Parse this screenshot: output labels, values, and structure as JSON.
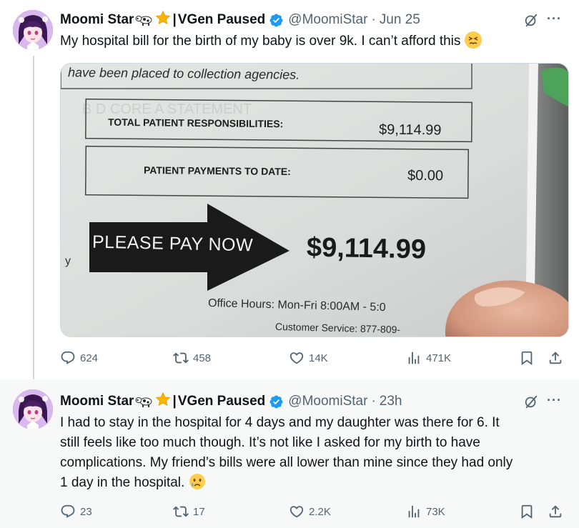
{
  "tweets": [
    {
      "author": {
        "display_name": "Moomi Star",
        "emoji_cow": "🐄",
        "emoji_star": "⭐",
        "separator": "|",
        "display_suffix": "VGen Paused",
        "handle": "@MoomiStar",
        "verified": true
      },
      "time": "Jun 25",
      "text": "My hospital bill for the birth of my baby is over 9k. I can’t afford this",
      "emoji": "😣",
      "media": {
        "bill": {
          "top_line": "have been placed to collection agencies.",
          "row1_label": "TOTAL PATIENT RESPONSIBILITIES:",
          "row1_value": "$9,114.99",
          "row2_label": "PATIENT PAYMENTS TO DATE:",
          "row2_value": "$0.00",
          "arrow_text": "PLEASE PAY NOW",
          "big_amount": "$9,114.99",
          "margin_char": "y",
          "office_hours": "Office Hours:  Mon-Fri 8:00AM - 5:0",
          "customer_service": "Customer Service:  877-809-"
        }
      },
      "stats": {
        "replies": "624",
        "reposts": "458",
        "likes": "14K",
        "views": "471K"
      }
    },
    {
      "author": {
        "display_name": "Moomi Star",
        "emoji_cow": "🐄",
        "emoji_star": "⭐",
        "separator": "|",
        "display_suffix": "VGen Paused",
        "handle": "@MoomiStar",
        "verified": true
      },
      "time": "23h",
      "text_lines": [
        "I had to stay in the hospital for 4 days and my daughter was there for 6. It",
        "still feels like too much though. It’s not like I asked for my birth to have",
        "complications. My friend’s bills were all lower than mine since they had only",
        "1 day in the hospital."
      ],
      "emoji": "😥",
      "stats": {
        "replies": "23",
        "reposts": "17",
        "likes": "2.2K",
        "views": "73K"
      }
    }
  ],
  "separators": {
    "dot": "·",
    "more": "···"
  },
  "icons": [
    "grok-icon",
    "more-icon",
    "reply-icon",
    "repost-icon",
    "like-icon",
    "views-icon",
    "bookmark-icon",
    "share-icon",
    "verified-badge-icon"
  ],
  "colors": {
    "text": "#0f1419",
    "muted": "#536471",
    "verified": "#1d9bf0",
    "thread_line": "#cfd9de",
    "second_bg": "#f7f9f9"
  }
}
